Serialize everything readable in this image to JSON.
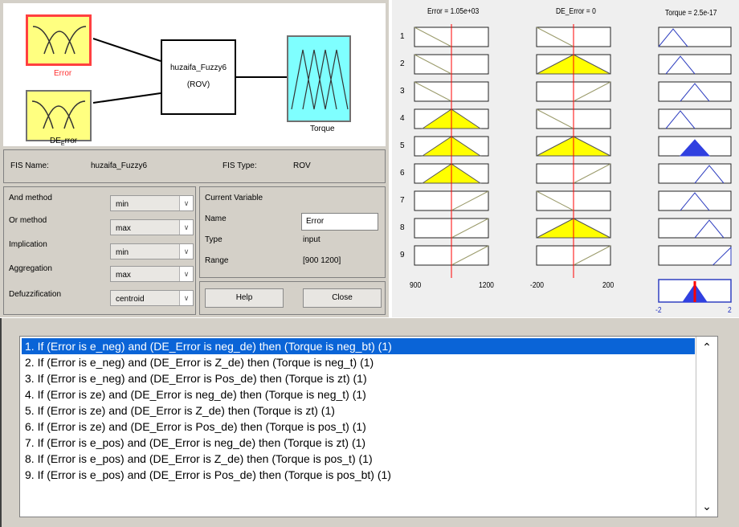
{
  "fis_editor": {
    "inputs": [
      {
        "name": "Error",
        "color_label": "#ff3030"
      },
      {
        "name": "DE_Error",
        "display_main": "DE",
        "display_sub": "E",
        "display_rest": "rror"
      }
    ],
    "system_name": "huzaifa_Fuzzy6",
    "system_type": "(ROV)",
    "output": {
      "name": "Torque"
    },
    "fis_name_label": "FIS Name:",
    "fis_name_value": "huzaifa_Fuzzy6",
    "fis_type_label": "FIS Type:",
    "fis_type_value": "ROV",
    "methods": [
      {
        "label": "And method",
        "value": "min"
      },
      {
        "label": "Or method",
        "value": "max"
      },
      {
        "label": "Implication",
        "value": "min"
      },
      {
        "label": "Aggregation",
        "value": "max"
      },
      {
        "label": "Defuzzification",
        "value": "centroid"
      }
    ],
    "current_variable": {
      "title": "Current Variable",
      "name_label": "Name",
      "name_value": "Error",
      "type_label": "Type",
      "type_value": "input",
      "range_label": "Range",
      "range_value": "[900 1200]"
    },
    "help_label": "Help",
    "close_label": "Close",
    "colors": {
      "input_box": "#ffff80",
      "output_box": "#7fffff",
      "panel": "#d4d0c8"
    }
  },
  "rule_viewer": {
    "columns": [
      {
        "title": "Error = 1.05e+03",
        "axis_min": "900",
        "axis_max": "1200"
      },
      {
        "title": "DE_Error = 0",
        "axis_min": "-200",
        "axis_max": "200"
      },
      {
        "title": "Torque = 2.5e-17",
        "axis_min": "-2",
        "axis_max": "2"
      }
    ],
    "row_numbers": [
      "1",
      "2",
      "3",
      "4",
      "5",
      "6",
      "7",
      "8",
      "9"
    ],
    "input_values": {
      "error": 1050,
      "de_error": 0,
      "torque": 2.5e-17
    },
    "colors": {
      "fill": "#ffff00",
      "output_fill": "#3040e0",
      "marker": "#ff0000"
    }
  },
  "rules": [
    "1. If (Error is e_neg) and (DE_Error is neg_de) then (Torque is neg_bt) (1)",
    "2. If (Error is e_neg) and (DE_Error is Z_de) then (Torque is neg_t) (1)",
    "3. If (Error is e_neg) and (DE_Error is Pos_de) then (Torque is zt) (1)",
    "4. If (Error is ze) and (DE_Error is neg_de) then (Torque is neg_t) (1)",
    "5. If (Error is ze) and (DE_Error is Z_de) then (Torque is zt) (1)",
    "6. If (Error is ze) and (DE_Error is Pos_de) then (Torque is pos_t) (1)",
    "7. If (Error is e_pos) and (DE_Error is neg_de) then (Torque is zt) (1)",
    "8. If (Error is e_pos) and (DE_Error is Z_de) then (Torque is pos_t) (1)",
    "9. If (Error is e_pos) and (DE_Error is Pos_de) then (Torque is pos_bt) (1)"
  ],
  "selected_rule": 1,
  "icons": {
    "dropdown": "chevron-down-icon",
    "scroll_up": "caret-up-icon",
    "scroll_down": "caret-down-icon"
  }
}
